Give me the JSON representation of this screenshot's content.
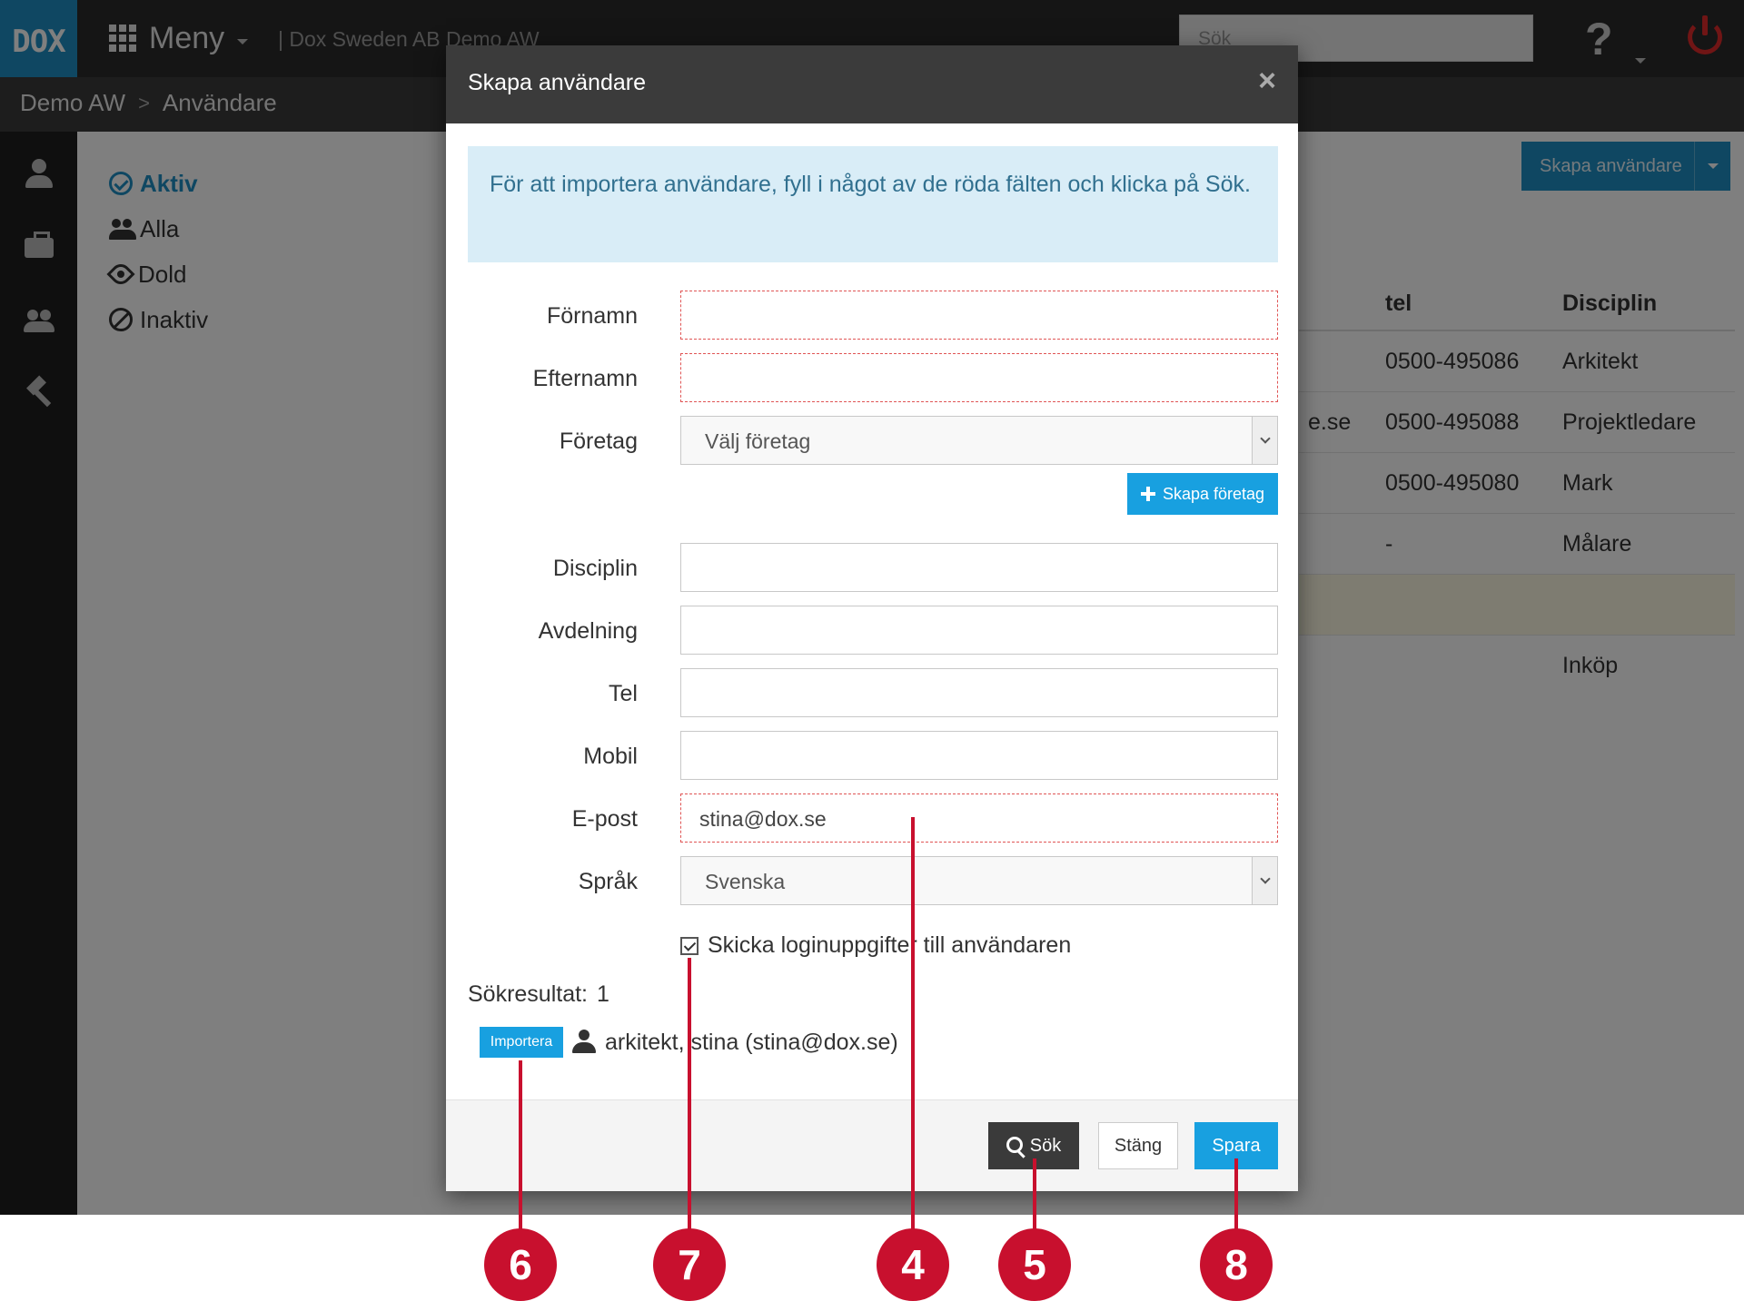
{
  "topbar": {
    "logo": "DOX",
    "menu_label": "Meny",
    "company": "| Dox Sweden AB   Demo AW",
    "search_placeholder": "Sök",
    "help_icon": "?"
  },
  "breadcrumb": {
    "items": [
      "Demo AW",
      "Användare"
    ],
    "separator": ">"
  },
  "sidebar": {
    "icons": [
      "user-icon",
      "briefcase-icon",
      "users-icon",
      "hammer-icon"
    ]
  },
  "filters": {
    "items": [
      {
        "label": "Aktiv",
        "icon": "check-circle-icon",
        "active": true
      },
      {
        "label": "Alla",
        "icon": "users-icon",
        "active": false
      },
      {
        "label": "Dold",
        "icon": "eye-slash-icon",
        "active": false
      },
      {
        "label": "Inaktiv",
        "icon": "block-icon",
        "active": false
      }
    ]
  },
  "page": {
    "create_user_button": "Skapa användare"
  },
  "bg_table": {
    "headers": {
      "tel": "tel",
      "disciplin": "Disciplin"
    },
    "rows": [
      {
        "email": "",
        "tel": "0500-495086",
        "disciplin": "Arkitekt"
      },
      {
        "email": "e.se",
        "tel": "0500-495088",
        "disciplin": "Projektledare"
      },
      {
        "email": "",
        "tel": "0500-495080",
        "disciplin": "Mark"
      },
      {
        "email": "",
        "tel": "-",
        "disciplin": "Målare"
      },
      {
        "email": "",
        "tel": "",
        "disciplin": ""
      },
      {
        "email": "",
        "tel": "",
        "disciplin": "Inköp"
      }
    ]
  },
  "modal": {
    "title": "Skapa användare",
    "close": "×",
    "info": "För att importera användare, fyll i något av de röda fälten och klicka på Sök.",
    "fields": {
      "fornamn": {
        "label": "Förnamn",
        "value": ""
      },
      "efternamn": {
        "label": "Efternamn",
        "value": ""
      },
      "foretag": {
        "label": "Företag",
        "value": "Välj företag"
      },
      "disciplin": {
        "label": "Disciplin",
        "value": ""
      },
      "avdelning": {
        "label": "Avdelning",
        "value": ""
      },
      "tel": {
        "label": "Tel",
        "value": ""
      },
      "mobil": {
        "label": "Mobil",
        "value": ""
      },
      "epost": {
        "label": "E-post",
        "value": "stina@dox.se"
      },
      "sprak": {
        "label": "Språk",
        "value": "Svenska"
      }
    },
    "create_company_button": "Skapa företag",
    "send_login_checkbox": {
      "label": "Skicka loginuppgifter till användaren",
      "checked": true
    },
    "search_results": {
      "label": "Sökresultat:",
      "count": "1"
    },
    "result": {
      "import_button": "Importera",
      "text": "arkitekt, stina (stina@dox.se)"
    },
    "footer": {
      "search": "Sök",
      "close": "Stäng",
      "save": "Spara"
    }
  },
  "callouts": [
    "6",
    "7",
    "4",
    "5",
    "8"
  ],
  "colors": {
    "accent": "#18a0e0",
    "callout": "#c8102e",
    "required": "#e05555"
  }
}
